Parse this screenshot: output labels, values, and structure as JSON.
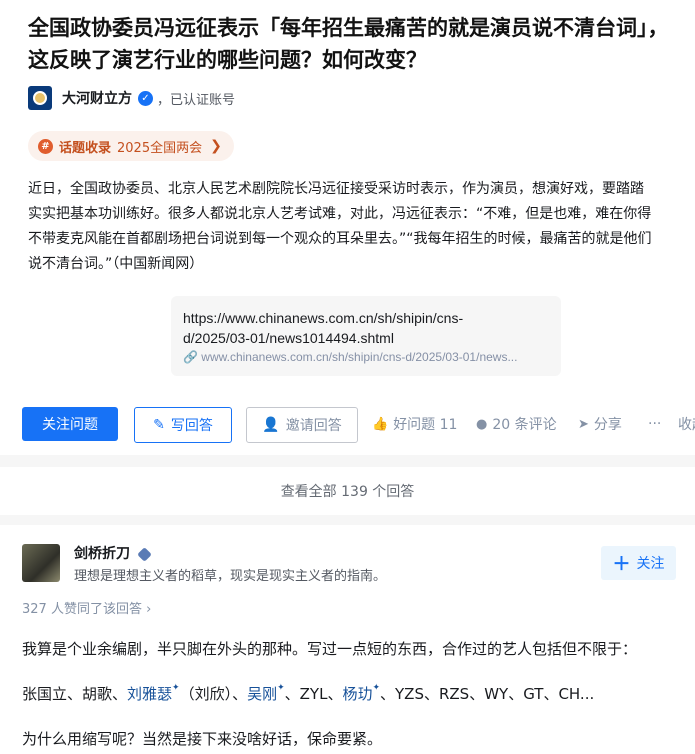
{
  "question": {
    "title": "全国政协委员冯远征表示「每年招生最痛苦的就是演员说不清台词」，这反映了演艺行业的哪些问题？如何改变？",
    "author": "大河财立方",
    "verified_label": "，已认证账号",
    "topic_label": "话题收录",
    "topic_name": "2025全国两会",
    "desc_lines": [
      "近日，全国政协委员、北京人民艺术剧院院长冯远征接受采访时表示，作为演员，想演好戏，要踏踏",
      "实实把基本功训练好。很多人都说北京人艺考试难，对此，冯远征表示：“不难，但是也难，难在你得",
      "不带麦克风能在首都剧场把台词说到每一个观众的耳朵里去。”“我每年招生的时候，最痛苦的就是他们",
      "说不清台词。”（中国新闻网）"
    ],
    "link_title": "https://www.chinanews.com.cn/sh/shipin/cns-d/2025/03-01/news1014494.shtml",
    "link_url": "www.chinanews.com.cn/sh/shipin/cns-d/2025/03-01/news..."
  },
  "actions": {
    "follow": "关注问题",
    "write": "写回答",
    "invite": "邀请回答",
    "good_question": "好问题 11",
    "comments": "20 条评论",
    "share": "分享",
    "more": "···",
    "collapse": "收起"
  },
  "all_answers": "查看全部 139 个回答",
  "answer": {
    "name": "剑桥折刀",
    "bio": "理想是理想主义者的稻草，现实是现实主义者的指南。",
    "follow": "关注",
    "votes": "327 人赞同了该回答",
    "p1": "我算是个业余编剧，半只脚在外头的那种。写过一点短的东西，合作过的艺人包括但不限于：",
    "p2": {
      "a": "张国立、胡歌、",
      "b": "刘雅瑟",
      "c": "（刘欣）、",
      "d": "吴刚",
      "e": "、ZYL、",
      "f": "杨玏",
      "g": "、YZS、RZS、WY、GT、CH..."
    },
    "p3": "为什么用缩写呢？当然是接下来没啥好话，保命要紧。"
  },
  "colors": {
    "primary": "#1772f6",
    "topic": "#c4501f",
    "link": "#175199"
  }
}
